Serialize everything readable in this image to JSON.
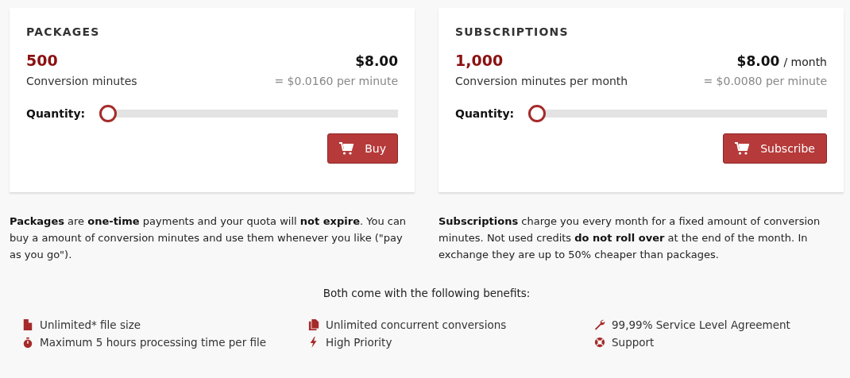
{
  "plans": [
    {
      "title": "PACKAGES",
      "amount": "500",
      "unit": "Conversion minutes",
      "price": "$8.00",
      "per_minute": "= $0.0160 per minute",
      "quantity_label": "Quantity:",
      "level": 0,
      "button": "Buy",
      "description": "**Packages** are **one-time** payments and your quota will **not expire**. You can buy a amount of conversion minutes and use them whenever you like (\"pay as you go\")."
    },
    {
      "title": "SUBSCRIPTIONS",
      "amount": "1,000",
      "unit": "Conversion minutes per month",
      "price": "$8.00",
      "period": "/ month",
      "per_minute": "= $0.0080 per minute",
      "quantity_label": "Quantity:",
      "level": 0,
      "button": "Subscribe",
      "description": "**Subscriptions** charge you every month for a fixed amount of conversion minutes. Not used credits **do not roll over** at the end of the month. In exchange they are up to 50% cheaper than packages."
    }
  ],
  "benefits_heading": "Both come with the following benefits:",
  "benefits": [
    {
      "kind": "file",
      "text": "Unlimited* file size"
    },
    {
      "kind": "files",
      "text": "Unlimited concurrent conversions"
    },
    {
      "kind": "wrench",
      "text": "99,99% Service Level Agreement"
    },
    {
      "kind": "stopwatch",
      "text": "Maximum 5 hours processing time per file"
    },
    {
      "kind": "bolt",
      "text": "High Priority"
    },
    {
      "kind": "lifebuoy",
      "text": "Support"
    }
  ]
}
